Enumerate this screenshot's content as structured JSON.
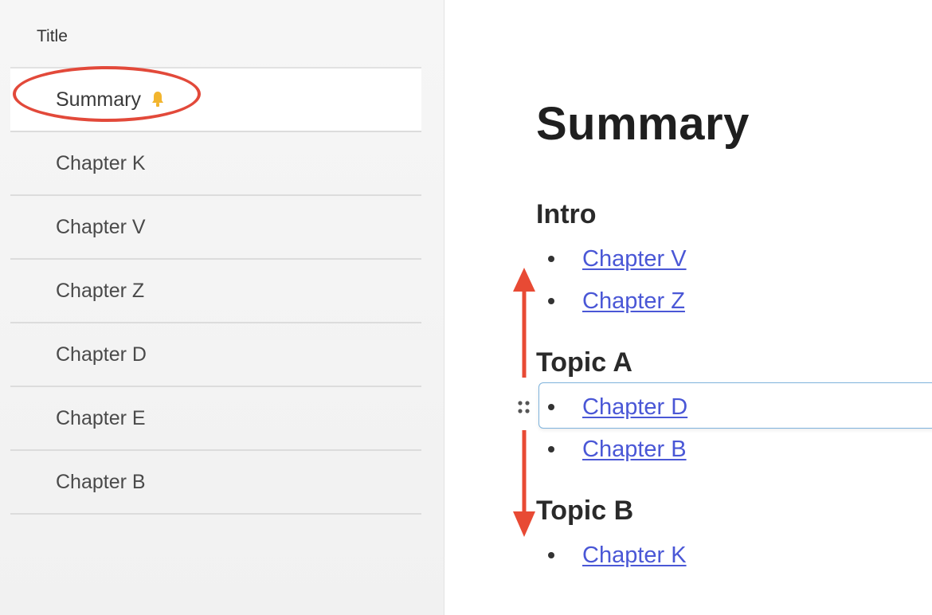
{
  "sidebar": {
    "title": "Title",
    "items": [
      {
        "label": "Summary",
        "active": true,
        "pinned": true
      },
      {
        "label": "Chapter K"
      },
      {
        "label": "Chapter V"
      },
      {
        "label": "Chapter Z"
      },
      {
        "label": "Chapter D"
      },
      {
        "label": "Chapter E"
      },
      {
        "label": "Chapter B"
      }
    ]
  },
  "main": {
    "title": "Summary",
    "sections": [
      {
        "heading": "Intro",
        "links": [
          "Chapter V",
          "Chapter Z"
        ]
      },
      {
        "heading": "Topic A",
        "links": [
          "Chapter D",
          "Chapter B"
        ]
      },
      {
        "heading": "Topic B",
        "links": [
          "Chapter K"
        ]
      }
    ],
    "selected_link": "Chapter D"
  },
  "annotations": {
    "highlight_color": "#e2493a",
    "arrow_color": "#e84a34"
  },
  "icons": {
    "pinned": "bell-icon",
    "drag": "drag-handle-icon"
  },
  "colors": {
    "link": "#4a57d6",
    "selection_border": "#7fb3dc"
  }
}
